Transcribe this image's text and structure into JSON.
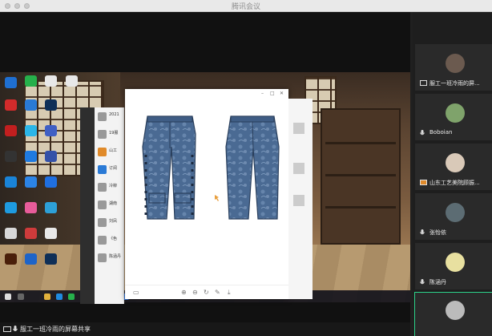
{
  "window": {
    "title": "腾讯会议"
  },
  "share": {
    "banner": "服工一班冷雨的屏幕共享"
  },
  "participants": [
    {
      "name": "服工一班冷雨的屏...",
      "avatar_color": "#6b5a4f",
      "icon": "screen-share-icon"
    },
    {
      "name": "Boboian",
      "avatar_color": "#7fa36b",
      "icon": "mic-icon"
    },
    {
      "name": "山东工艺美院顾振...",
      "avatar_color": "#d9c9b8",
      "icon": "screen-share-icon"
    },
    {
      "name": "张怡依",
      "avatar_color": "#5c6c73",
      "icon": "mic-icon"
    },
    {
      "name": "陈涵丹",
      "avatar_color": "#e8e0a0",
      "icon": "mic-icon"
    }
  ],
  "wechat": {
    "rows": [
      {
        "title": "2021",
        "sub": ""
      },
      {
        "title": "19服",
        "sub": ""
      },
      {
        "title": "山工",
        "sub": ""
      },
      {
        "title": "订阅",
        "sub": ""
      },
      {
        "title": "冷柳",
        "sub": ""
      },
      {
        "title": "湖南",
        "sub": ""
      },
      {
        "title": "刘凤",
        "sub": ""
      },
      {
        "title": "《色",
        "sub": ""
      },
      {
        "title": "陈涵丹",
        "sub": ""
      }
    ]
  },
  "colors": {
    "accent": "#2cd38a",
    "denim": "#4a6a93"
  }
}
